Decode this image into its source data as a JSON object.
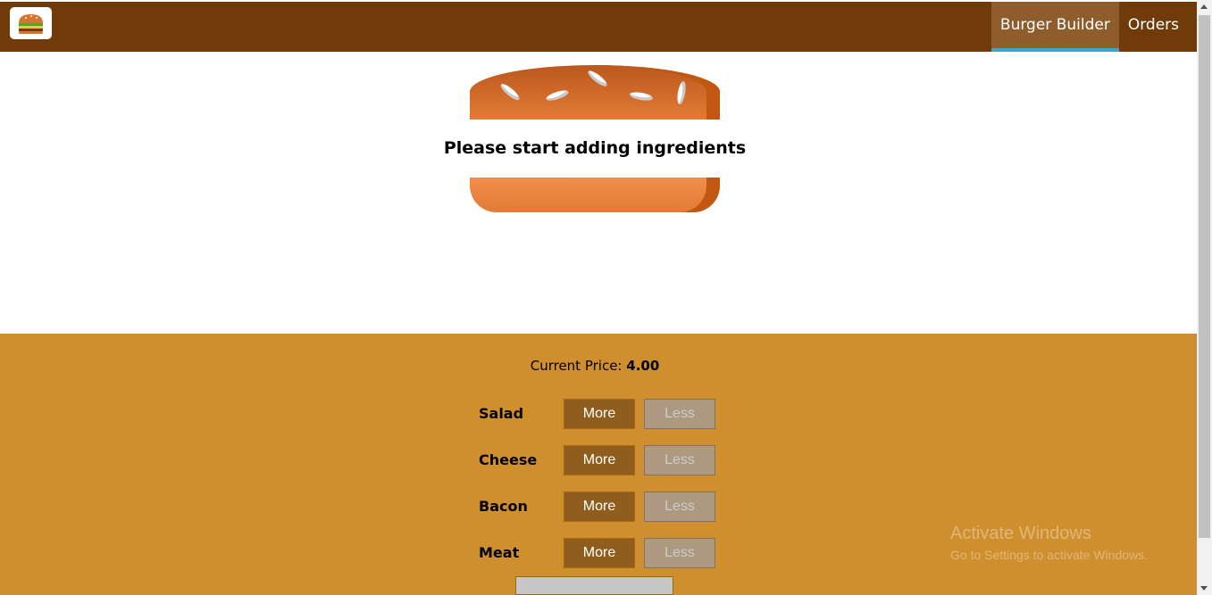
{
  "header": {
    "logo_icon": "burger-logo-icon",
    "nav": [
      {
        "label": "Burger Builder",
        "active": true
      },
      {
        "label": "Orders",
        "active": false
      }
    ],
    "colors": {
      "toolbar": "#703B09",
      "active_tab": "#8F5C2C",
      "active_underline": "#40A4C8"
    }
  },
  "burger": {
    "empty_message": "Please start adding ingredients"
  },
  "controls": {
    "price_label": "Current Price:",
    "price_value": "4.00",
    "ingredients": [
      {
        "label": "Salad",
        "more": "More",
        "less": "Less"
      },
      {
        "label": "Cheese",
        "more": "More",
        "less": "Less"
      },
      {
        "label": "Bacon",
        "more": "More",
        "less": "Less"
      },
      {
        "label": "Meat",
        "more": "More",
        "less": "Less"
      }
    ],
    "colors": {
      "panel": "#CF8F2E",
      "more_button": "#8F5E1E",
      "less_button_disabled": "#AC9980"
    }
  },
  "watermark": {
    "line1": "Activate Windows",
    "line2": "Go to Settings to activate Windows."
  }
}
